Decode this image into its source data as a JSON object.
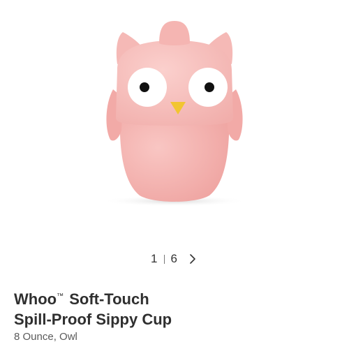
{
  "gallery": {
    "current_page": "1",
    "total_pages": "6",
    "next_icon": "chevron-right-icon",
    "image_subject": "owl-sippy-cup",
    "colors": {
      "cup_body": "#f5b4b2",
      "cup_head": "#f7c0bd",
      "beak": "#f2c531",
      "eye_white": "#ffffff",
      "pupil": "#111111"
    }
  },
  "product": {
    "title_brand": "Whoo",
    "title_tm": "™",
    "title_rest_line1": "Soft-Touch",
    "title_line2": "Spill-Proof Sippy Cup",
    "variant": "8 Ounce, Owl"
  }
}
